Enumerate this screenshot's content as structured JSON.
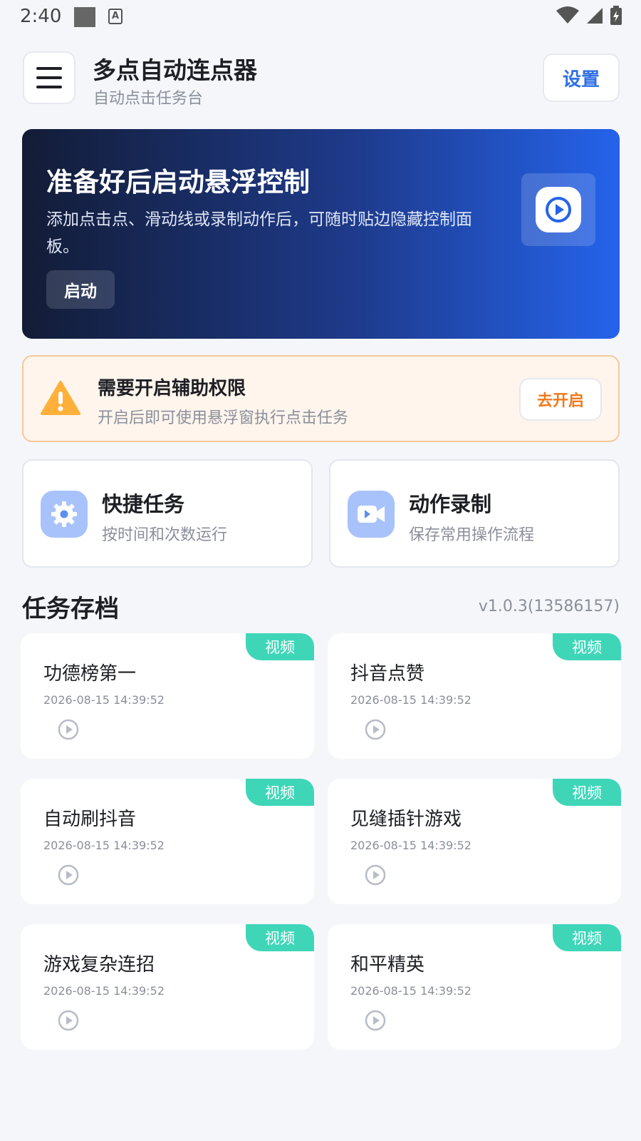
{
  "status": {
    "time": "2:40"
  },
  "header": {
    "title": "多点自动连点器",
    "subtitle": "自动点击任务台",
    "settings_label": "设置"
  },
  "hero": {
    "title": "准备好后启动悬浮控制",
    "description": "添加点击点、滑动线或录制动作后，可随时贴边隐藏控制面板。",
    "start_label": "启动"
  },
  "warning": {
    "title": "需要开启辅助权限",
    "description": "开启后即可使用悬浮窗执行点击任务",
    "button_label": "去开启"
  },
  "quick": [
    {
      "title": "快捷任务",
      "description": "按时间和次数运行",
      "icon": "gear-icon"
    },
    {
      "title": "动作录制",
      "description": "保存常用操作流程",
      "icon": "video-camera-icon"
    }
  ],
  "archive": {
    "title": "任务存档",
    "version": "v1.0.3(13586157)",
    "tasks": [
      {
        "name": "功德榜第一",
        "date": "2026-08-15 14:39:52",
        "badge": "视频"
      },
      {
        "name": "抖音点赞",
        "date": "2026-08-15 14:39:52",
        "badge": "视频"
      },
      {
        "name": "自动刷抖音",
        "date": "2026-08-15 14:39:52",
        "badge": "视频"
      },
      {
        "name": "见缝插针游戏",
        "date": "2026-08-15 14:39:52",
        "badge": "视频"
      },
      {
        "name": "游戏复杂连招",
        "date": "2026-08-15 14:39:52",
        "badge": "视频"
      },
      {
        "name": "和平精英",
        "date": "2026-08-15 14:39:52",
        "badge": "视频"
      }
    ]
  },
  "colors": {
    "accent": "#2f6ee6",
    "warning": "#f07a1e",
    "badge": "#3fd6b8",
    "hero_start": "#131c36",
    "hero_end": "#2563eb"
  }
}
